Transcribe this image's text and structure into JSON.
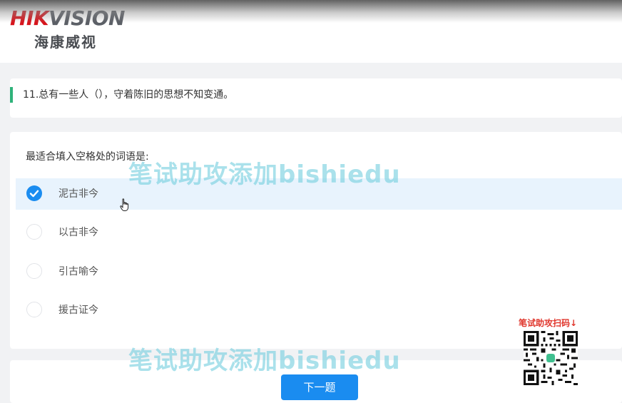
{
  "brand": {
    "logo_en_red": "HIK",
    "logo_en_gray": "VISION",
    "logo_cn": "海康威视",
    "accent_color": "#d7141c"
  },
  "question": {
    "text": "11.总有一些人（），守着陈旧的思想不知变通。",
    "bar_color": "#2fb27a"
  },
  "answer": {
    "prompt": "最适合填入空格处的词语是:",
    "options": [
      {
        "label": "泥古非今",
        "selected": true
      },
      {
        "label": "以古非今",
        "selected": false
      },
      {
        "label": "引古喻今",
        "selected": false
      },
      {
        "label": "援古证今",
        "selected": false
      }
    ],
    "selected_color": "#1a8cf0"
  },
  "next_button": {
    "label": "下一题"
  },
  "watermark": {
    "text": "笔试助攻添加bishiedu",
    "qr_label": "笔试助攻扫码↓"
  },
  "icons": {
    "check": "check-icon",
    "cursor": "hand-cursor-icon",
    "qr": "qr-code-icon"
  }
}
